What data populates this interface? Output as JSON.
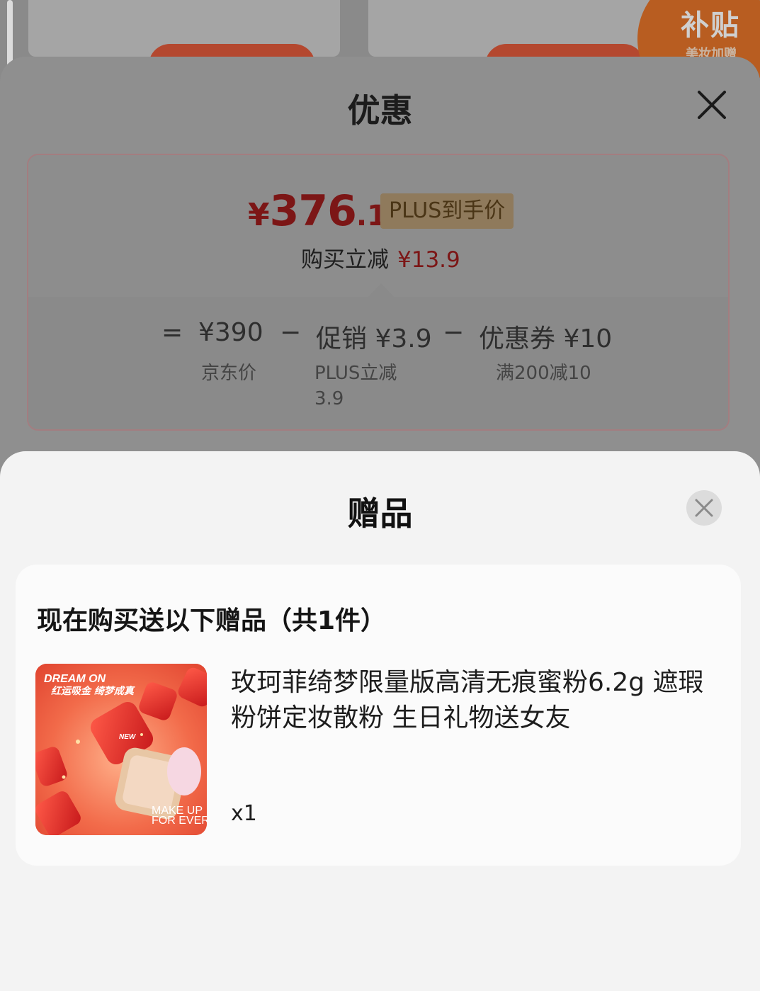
{
  "background": {
    "subsidy_badge": "补贴",
    "subsidy_sub": "美妆加赠"
  },
  "offer_sheet": {
    "title": "优惠",
    "plus_price": {
      "currency": "¥",
      "integer": "376",
      "decimal": ".1"
    },
    "plus_tag": "PLUS到手价",
    "instant_reduce": {
      "label": "购买立减",
      "amount": "¥13.9"
    },
    "formula": [
      {
        "symbol": "=",
        "value": "¥390",
        "caption": "京东价"
      },
      {
        "symbol": "−",
        "value": "促销 ¥3.9",
        "caption": "PLUS立减",
        "caption2": "3.9"
      },
      {
        "symbol": "−",
        "value": "优惠券 ¥10",
        "caption": "满200减10"
      }
    ]
  },
  "gift_sheet": {
    "title": "赠品",
    "heading": "现在购买送以下赠品（共1件）",
    "product": {
      "name": "玫珂菲绮梦限量版高清无痕蜜粉6.2g 遮瑕粉饼定妆散粉 生日礼物送女友",
      "quantity": "x1",
      "image_text": {
        "line1": "DREAM ON",
        "line2": "红运吸金 绮梦成真",
        "new": "NEW",
        "brand1": "MAKE UP",
        "brand2": "FOR EVER"
      }
    }
  },
  "colors": {
    "price_red": "#e0262a",
    "gift_bg": "#f3f3f3",
    "card_bg": "#fbfbfb"
  }
}
